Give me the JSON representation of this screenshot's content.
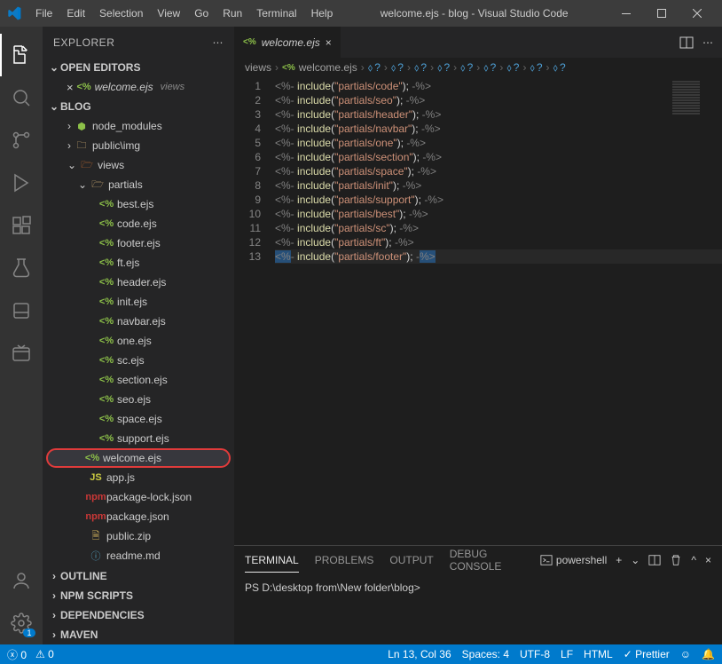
{
  "title": "welcome.ejs - blog - Visual Studio Code",
  "menu": [
    "File",
    "Edit",
    "Selection",
    "View",
    "Go",
    "Run",
    "Terminal",
    "Help"
  ],
  "explorer": {
    "title": "EXPLORER",
    "openEditors": "OPEN EDITORS",
    "blog": "BLOG",
    "outline": "OUTLINE",
    "npm": "NPM SCRIPTS",
    "deps": "DEPENDENCIES",
    "maven": "MAVEN"
  },
  "openEditor": {
    "name": "welcome.ejs",
    "desc": "views"
  },
  "tree": {
    "node_modules": "node_modules",
    "public_img": "public\\img",
    "views": "views",
    "partials": "partials",
    "files": [
      "best.ejs",
      "code.ejs",
      "footer.ejs",
      "ft.ejs",
      "header.ejs",
      "init.ejs",
      "navbar.ejs",
      "one.ejs",
      "sc.ejs",
      "section.ejs",
      "seo.ejs",
      "space.ejs",
      "support.ejs"
    ],
    "welcome": "welcome.ejs",
    "appjs": "app.js",
    "pkglock": "package-lock.json",
    "pkg": "package.json",
    "publiczip": "public.zip",
    "readme": "readme.md"
  },
  "tab": {
    "name": "welcome.ejs"
  },
  "breadcrumbs": {
    "views": "views",
    "welcome": "welcome.ejs",
    "q": "?"
  },
  "code": [
    {
      "n": "1",
      "p": "partials/code"
    },
    {
      "n": "2",
      "p": "partials/seo"
    },
    {
      "n": "3",
      "p": "partials/header"
    },
    {
      "n": "4",
      "p": "partials/navbar"
    },
    {
      "n": "5",
      "p": "partials/one"
    },
    {
      "n": "6",
      "p": "partials/section"
    },
    {
      "n": "7",
      "p": "partials/space"
    },
    {
      "n": "8",
      "p": "partials/init"
    },
    {
      "n": "9",
      "p": "partials/support"
    },
    {
      "n": "10",
      "p": "partials/best"
    },
    {
      "n": "11",
      "p": "partials/sc"
    },
    {
      "n": "12",
      "p": "partials/ft"
    },
    {
      "n": "13",
      "p": "partials/footer"
    }
  ],
  "terminal": {
    "tabs": {
      "terminal": "TERMINAL",
      "problems": "PROBLEMS",
      "output": "OUTPUT",
      "debug": "DEBUG CONSOLE"
    },
    "shell": "powershell",
    "prompt": "PS D:\\desktop from\\New folder\\blog>"
  },
  "status": {
    "errors": "0",
    "warnings": "0",
    "pos": "Ln 13, Col 36",
    "spaces": "Spaces: 4",
    "enc": "UTF-8",
    "eol": "LF",
    "lang": "HTML",
    "prettier": "Prettier"
  },
  "badge": "1"
}
